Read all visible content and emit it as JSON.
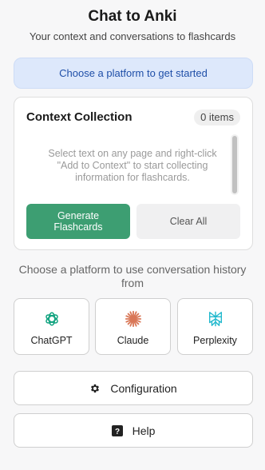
{
  "header": {
    "title": "Chat to Anki",
    "subtitle": "Your context and conversations to flashcards"
  },
  "banner": {
    "text": "Choose a platform to get started"
  },
  "context_panel": {
    "title": "Context Collection",
    "count_label": "0 items",
    "empty_message": "Select text on any page and right-click \"Add to Context\" to start collecting information for flashcards.",
    "generate_label": "Generate Flashcards",
    "clear_label": "Clear All",
    "generate_color": "#3d9e72"
  },
  "platforms": {
    "heading": "Choose a platform to use conversation history from",
    "items": [
      {
        "label": "ChatGPT",
        "icon": "chatgpt-icon",
        "color": "#10a37f"
      },
      {
        "label": "Claude",
        "icon": "claude-icon",
        "color": "#d97757"
      },
      {
        "label": "Perplexity",
        "icon": "perplexity-icon",
        "color": "#20b8cd"
      }
    ]
  },
  "footer_buttons": {
    "configuration_label": "Configuration",
    "help_label": "Help"
  }
}
